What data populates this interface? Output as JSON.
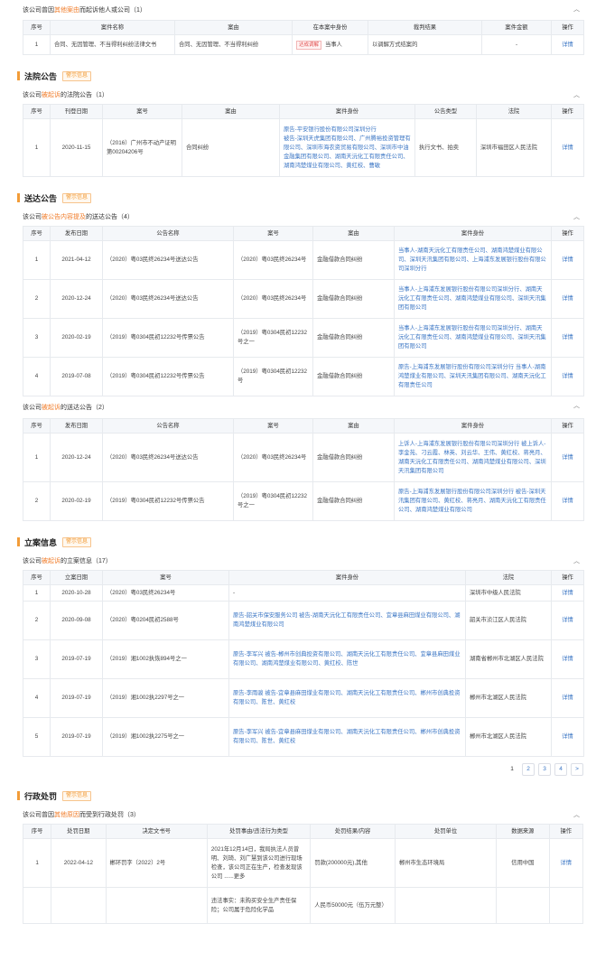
{
  "colors": {
    "accent": "#f29c38",
    "link": "#3a75c4",
    "highlight": "#f07b28",
    "header_bg": "#f5f7fa"
  },
  "top": {
    "subhead_pre": "该公司曾因",
    "subhead_hl": "其他案由",
    "subhead_post": "而起诉他人或公司（1）",
    "headers": [
      "序号",
      "案件名称",
      "案由",
      "在本案中身份",
      "裁判结果",
      "案件金额",
      "操作"
    ],
    "rows": [
      {
        "no": "1",
        "name": "合同、无因管理、不当得利纠纷法律文书",
        "cause": "合同、无因管理、不当得利纠纷",
        "badge": "达成调解",
        "role": "当事人",
        "result": "以调解方式结案的",
        "amount": "-",
        "op": "详情"
      }
    ]
  },
  "court_notice": {
    "title": "法院公告",
    "tag": "警示信息",
    "subhead_pre": "该公司",
    "subhead_hl": "被起诉",
    "subhead_post": "的法院公告（1）",
    "headers": [
      "序号",
      "刊登日期",
      "案号",
      "案由",
      "案件身份",
      "公告类型",
      "法院",
      "操作"
    ],
    "rows": [
      {
        "no": "1",
        "date": "2020-11-15",
        "case_no": "（2016）广州市不动产证明第00204206号",
        "cause": "合同纠纷",
        "parties": [
          "原告-平安银行股份有限公司深圳分行",
          "被告-深圳天虎集团有限公司、广州腾裕投资管理有限公司、深圳市海农资贸易有限公司、深圳市中油金融集团有限公司、湖南天沅化工有限责任公司、湖南鸿楚煤业有限公司、黄红校、曹敏"
        ],
        "type": "执行文书、拍卖",
        "court": "深圳市福田区人民法院",
        "op": "详情"
      }
    ]
  },
  "service_notice": {
    "title": "送达公告",
    "tag": "警示信息",
    "sub1_pre": "该公司",
    "sub1_hl": "被公告内容提及",
    "sub1_post": "的送达公告（4）",
    "headers": [
      "序号",
      "发布日期",
      "公告名称",
      "案号",
      "案由",
      "案件身份",
      "操作"
    ],
    "rows1": [
      {
        "no": "1",
        "date": "2021-04-12",
        "name": "（2020）粤03民终26234号送达公告",
        "case_no": "（2020）粤03民终26234号",
        "cause": "金融借款合同纠纷",
        "parties": "当事人-湖南天沅化工有限责任公司、湖南鸿楚煤业有限公司、深圳天汛集团有限公司、上海浦东发展银行股份有限公司深圳分行",
        "op": "详情"
      },
      {
        "no": "2",
        "date": "2020-12-24",
        "name": "（2020）粤03民终26234号送达公告",
        "case_no": "（2020）粤03民终26234号",
        "cause": "金融借款合同纠纷",
        "parties": "当事人-上海浦东发展银行股份有限公司深圳分行、湖南天沅化工有限责任公司、湖南鸿楚煤业有限公司、深圳天汛集团有限公司",
        "op": "详情"
      },
      {
        "no": "3",
        "date": "2020-02-19",
        "name": "（2019）粤0304民初12232号传票公告",
        "case_no": "（2019）粤0304民初12232号之一",
        "cause": "金融借款合同纠纷",
        "parties": "当事人-上海浦东发展银行股份有限公司深圳分行、湖南天沅化工有限责任公司、湖南鸿楚煤业有限公司、深圳天汛集团有限公司",
        "op": "详情"
      },
      {
        "no": "4",
        "date": "2019-07-08",
        "name": "（2019）粤0304民初12232号传票公告",
        "case_no": "（2019）粤0304民初12232号",
        "cause": "金融借款合同纠纷",
        "parties": "原告-上海浦东发展银行股份有限公司深圳分行 当事人-湖南鸿楚煤业有限公司、深圳天汛集团有限公司、湖南天沅化工有限责任公司",
        "op": "详情"
      }
    ],
    "sub2_pre": "该公司",
    "sub2_hl": "被起诉",
    "sub2_post": "的送达公告（2）",
    "rows2": [
      {
        "no": "1",
        "date": "2020-12-24",
        "name": "（2020）粤03民终26234号送达公告",
        "case_no": "（2020）粤03民终26234号",
        "cause": "金融借款合同纠纷",
        "parties": "上诉人-上海浦东发展银行股份有限公司深圳分行 被上诉人-李金苑、刁云霞、林英、刘云华、王伟、黄红校、蒋亮月、湖南天沅化工有限责任公司、湖南鸿楚煤业有限公司、深圳天汛集团有限公司",
        "op": "详情"
      },
      {
        "no": "2",
        "date": "2020-02-19",
        "name": "（2019）粤0304民初12232号传票公告",
        "case_no": "（2019）粤0304民初12232号之一",
        "cause": "金融借款合同纠纷",
        "parties": "原告-上海浦东发展银行股份有限公司深圳分行 被告-深圳天汛集团有限公司、黄红校、蒋亮月、湖南天沅化工有限责任公司、湖南鸿楚煤业有限公司",
        "op": "详情"
      }
    ]
  },
  "filing": {
    "title": "立案信息",
    "tag": "警示信息",
    "subhead_pre": "该公司",
    "subhead_hl": "被起诉",
    "subhead_post": "的立案信息（17）",
    "headers": [
      "序号",
      "立案日期",
      "案号",
      "案件身份",
      "法院",
      "操作"
    ],
    "rows": [
      {
        "no": "1",
        "date": "2020-10-28",
        "case_no": "（2020）粤03民终26234号",
        "parties": "-",
        "court": "深圳市中级人民法院",
        "op": "详情"
      },
      {
        "no": "2",
        "date": "2020-09-08",
        "case_no": "（2020）粤0204民初2588号",
        "parties": "原告-韶关市保安服务公司 被告-湖南天沅化工有限责任公司、宜章县麻田煤业有限公司、湖南鸿楚煤业有限公司",
        "court": "韶关市浈江区人民法院",
        "op": "详情"
      },
      {
        "no": "3",
        "date": "2019-07-19",
        "case_no": "（2019）湘1002执恢894号之一",
        "parties": "原告-李军兴 被告-郴州市创典投资有限公司、湖南天沅化工有限责任公司、宜章县麻田煤业有限公司、湖南鸿楚煤业有限公司、黄红校、陈世",
        "court": "湖南省郴州市北湖区人民法院",
        "op": "详情"
      },
      {
        "no": "4",
        "date": "2019-07-19",
        "case_no": "（2019）湘1002执2297号之一",
        "parties": "原告-李雨骏 被告-宜章县麻田煤业有限公司、湖南天沅化工有限责任公司、郴州市创典投资有限公司、陈世、黄红校",
        "court": "郴州市北湖区人民法院",
        "op": "详情"
      },
      {
        "no": "5",
        "date": "2019-07-19",
        "case_no": "（2019）湘1002执2275号之一",
        "parties": "原告-李军兴 被告-宜章县麻田煤业有限公司、湖南天沅化工有限责任公司、郴州市创典投资有限公司、陈世、黄红校",
        "court": "郴州市北湖区人民法院",
        "op": "详情"
      }
    ],
    "pager": [
      "1",
      "2",
      "3",
      "4",
      ">"
    ]
  },
  "admin_penalty": {
    "title": "行政处罚",
    "tag": "警示信息",
    "subhead_pre": "该公司曾因",
    "subhead_hl": "其他原因",
    "subhead_post": "而受到行政处罚（3）",
    "headers": [
      "序号",
      "处罚日期",
      "决定文书号",
      "处罚事由/违法行为类型",
      "处罚结果/内容",
      "处罚单位",
      "数据来源",
      "操作"
    ],
    "rows": [
      {
        "no": "1",
        "date": "2022-04-12",
        "doc": "郴环罚字〔2022〕2号",
        "reason": "2021年12月14日，我局执法人员曾明、刘琦、刘广慧到该公司进行现场检查，该公司正在生产，检查发现该公司 ......更多",
        "result": "罚款(200000元),其他",
        "unit": "郴州市生态环境局",
        "source": "信用中国",
        "op": "详情"
      },
      {
        "no": "",
        "date": "",
        "doc": "",
        "reason": "违法事实：未购买安全生产责任保险；公司属于危险化学品",
        "result": "人民币50000元（伍万元整）",
        "unit": "",
        "source": "",
        "op": ""
      }
    ]
  }
}
